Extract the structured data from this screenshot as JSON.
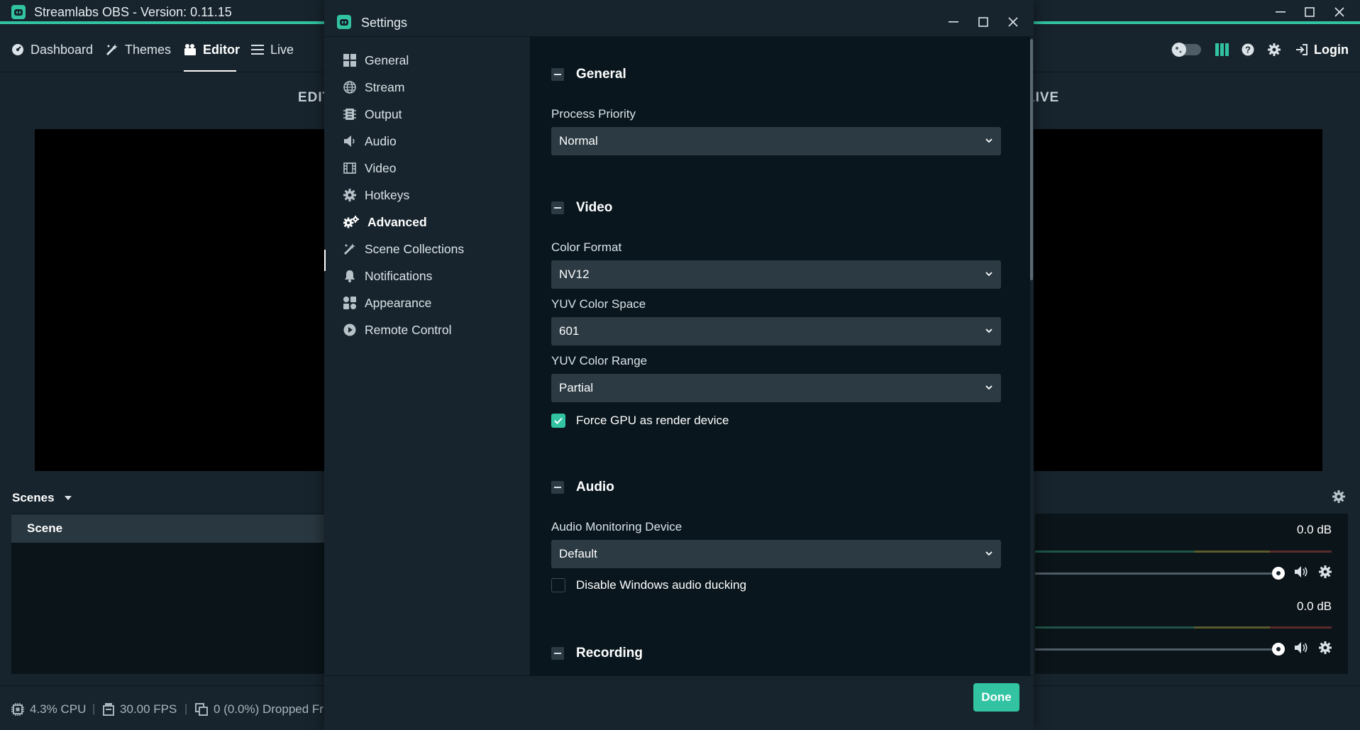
{
  "app": {
    "title": "Streamlabs OBS - Version: 0.11.15",
    "accent_color": "#31c3a2"
  },
  "nav": {
    "items": [
      {
        "label": "Dashboard",
        "icon": "dashboard-icon"
      },
      {
        "label": "Themes",
        "icon": "themes-icon"
      },
      {
        "label": "Editor",
        "icon": "editor-icon",
        "active": true
      },
      {
        "label": "Live",
        "icon": "live-icon"
      }
    ],
    "login_label": "Login"
  },
  "editor": {
    "left_label": "EDIT",
    "right_label": "LIVE"
  },
  "scenes": {
    "header": "Scenes",
    "items": [
      "Scene"
    ]
  },
  "mixer": {
    "channels": [
      {
        "db": "0.0 dB",
        "volume": 1.0
      },
      {
        "db": "0.0 dB",
        "volume": 1.0
      }
    ]
  },
  "status": {
    "cpu": "4.3% CPU",
    "fps": "30.00 FPS",
    "dropped": "0 (0.0%) Dropped Fr"
  },
  "settings": {
    "title": "Settings",
    "sidebar": [
      {
        "label": "General",
        "icon": "grid-icon"
      },
      {
        "label": "Stream",
        "icon": "globe-icon"
      },
      {
        "label": "Output",
        "icon": "output-icon"
      },
      {
        "label": "Audio",
        "icon": "speaker-icon"
      },
      {
        "label": "Video",
        "icon": "film-icon"
      },
      {
        "label": "Hotkeys",
        "icon": "gear-icon"
      },
      {
        "label": "Advanced",
        "icon": "gears-icon",
        "active": true
      },
      {
        "label": "Scene Collections",
        "icon": "wand-icon"
      },
      {
        "label": "Notifications",
        "icon": "bell-icon"
      },
      {
        "label": "Appearance",
        "icon": "palette-icon"
      },
      {
        "label": "Remote Control",
        "icon": "play-circle-icon"
      }
    ],
    "sections": {
      "general": {
        "title": "General",
        "process_priority_label": "Process Priority",
        "process_priority_value": "Normal"
      },
      "video": {
        "title": "Video",
        "color_format_label": "Color Format",
        "color_format_value": "NV12",
        "yuv_space_label": "YUV Color Space",
        "yuv_space_value": "601",
        "yuv_range_label": "YUV Color Range",
        "yuv_range_value": "Partial",
        "force_gpu_label": "Force GPU as render device",
        "force_gpu_checked": true
      },
      "audio": {
        "title": "Audio",
        "monitoring_label": "Audio Monitoring Device",
        "monitoring_value": "Default",
        "ducking_label": "Disable Windows audio ducking",
        "ducking_checked": false
      },
      "recording": {
        "title": "Recording"
      }
    },
    "done_label": "Done"
  }
}
